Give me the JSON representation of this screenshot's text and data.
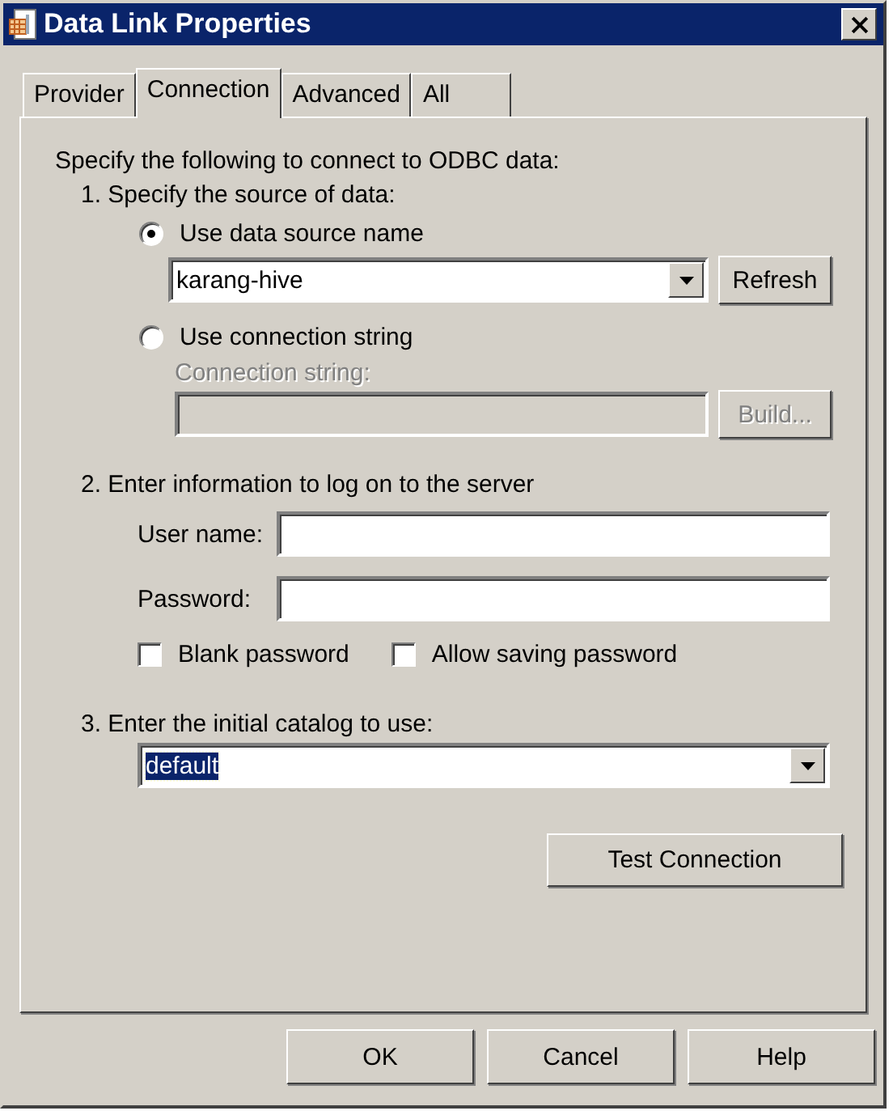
{
  "window": {
    "title": "Data Link Properties"
  },
  "tabs": [
    {
      "label": "Provider",
      "selected": false
    },
    {
      "label": "Connection",
      "selected": true
    },
    {
      "label": "Advanced",
      "selected": false
    },
    {
      "label": "All",
      "selected": false
    }
  ],
  "intro": "Specify the following to connect to ODBC data:",
  "source": {
    "heading": "1. Specify the source of data:",
    "options": [
      {
        "label": "Use data source name",
        "selected": true
      },
      {
        "label": "Use connection string",
        "selected": false
      }
    ],
    "dsn": {
      "value": "karang-hive"
    },
    "refresh_button": {
      "label": "Refresh",
      "disabled": false
    },
    "connection_string": {
      "label": "Connection string:",
      "disabled": true
    },
    "build_button": {
      "label": "Build...",
      "disabled": true
    }
  },
  "logon": {
    "heading": "2. Enter information to log on to the server",
    "fields": [
      {
        "label": "User name:"
      },
      {
        "label": "Password:"
      }
    ],
    "options": [
      {
        "label": "Blank password",
        "checked": false
      },
      {
        "label": "Allow saving password",
        "checked": false
      }
    ]
  },
  "catalog": {
    "heading": "3. Enter the initial catalog to use:",
    "value": "default",
    "highlighted": true
  },
  "test_button": "Test Connection",
  "buttons": [
    "OK",
    "Cancel",
    "Help"
  ]
}
